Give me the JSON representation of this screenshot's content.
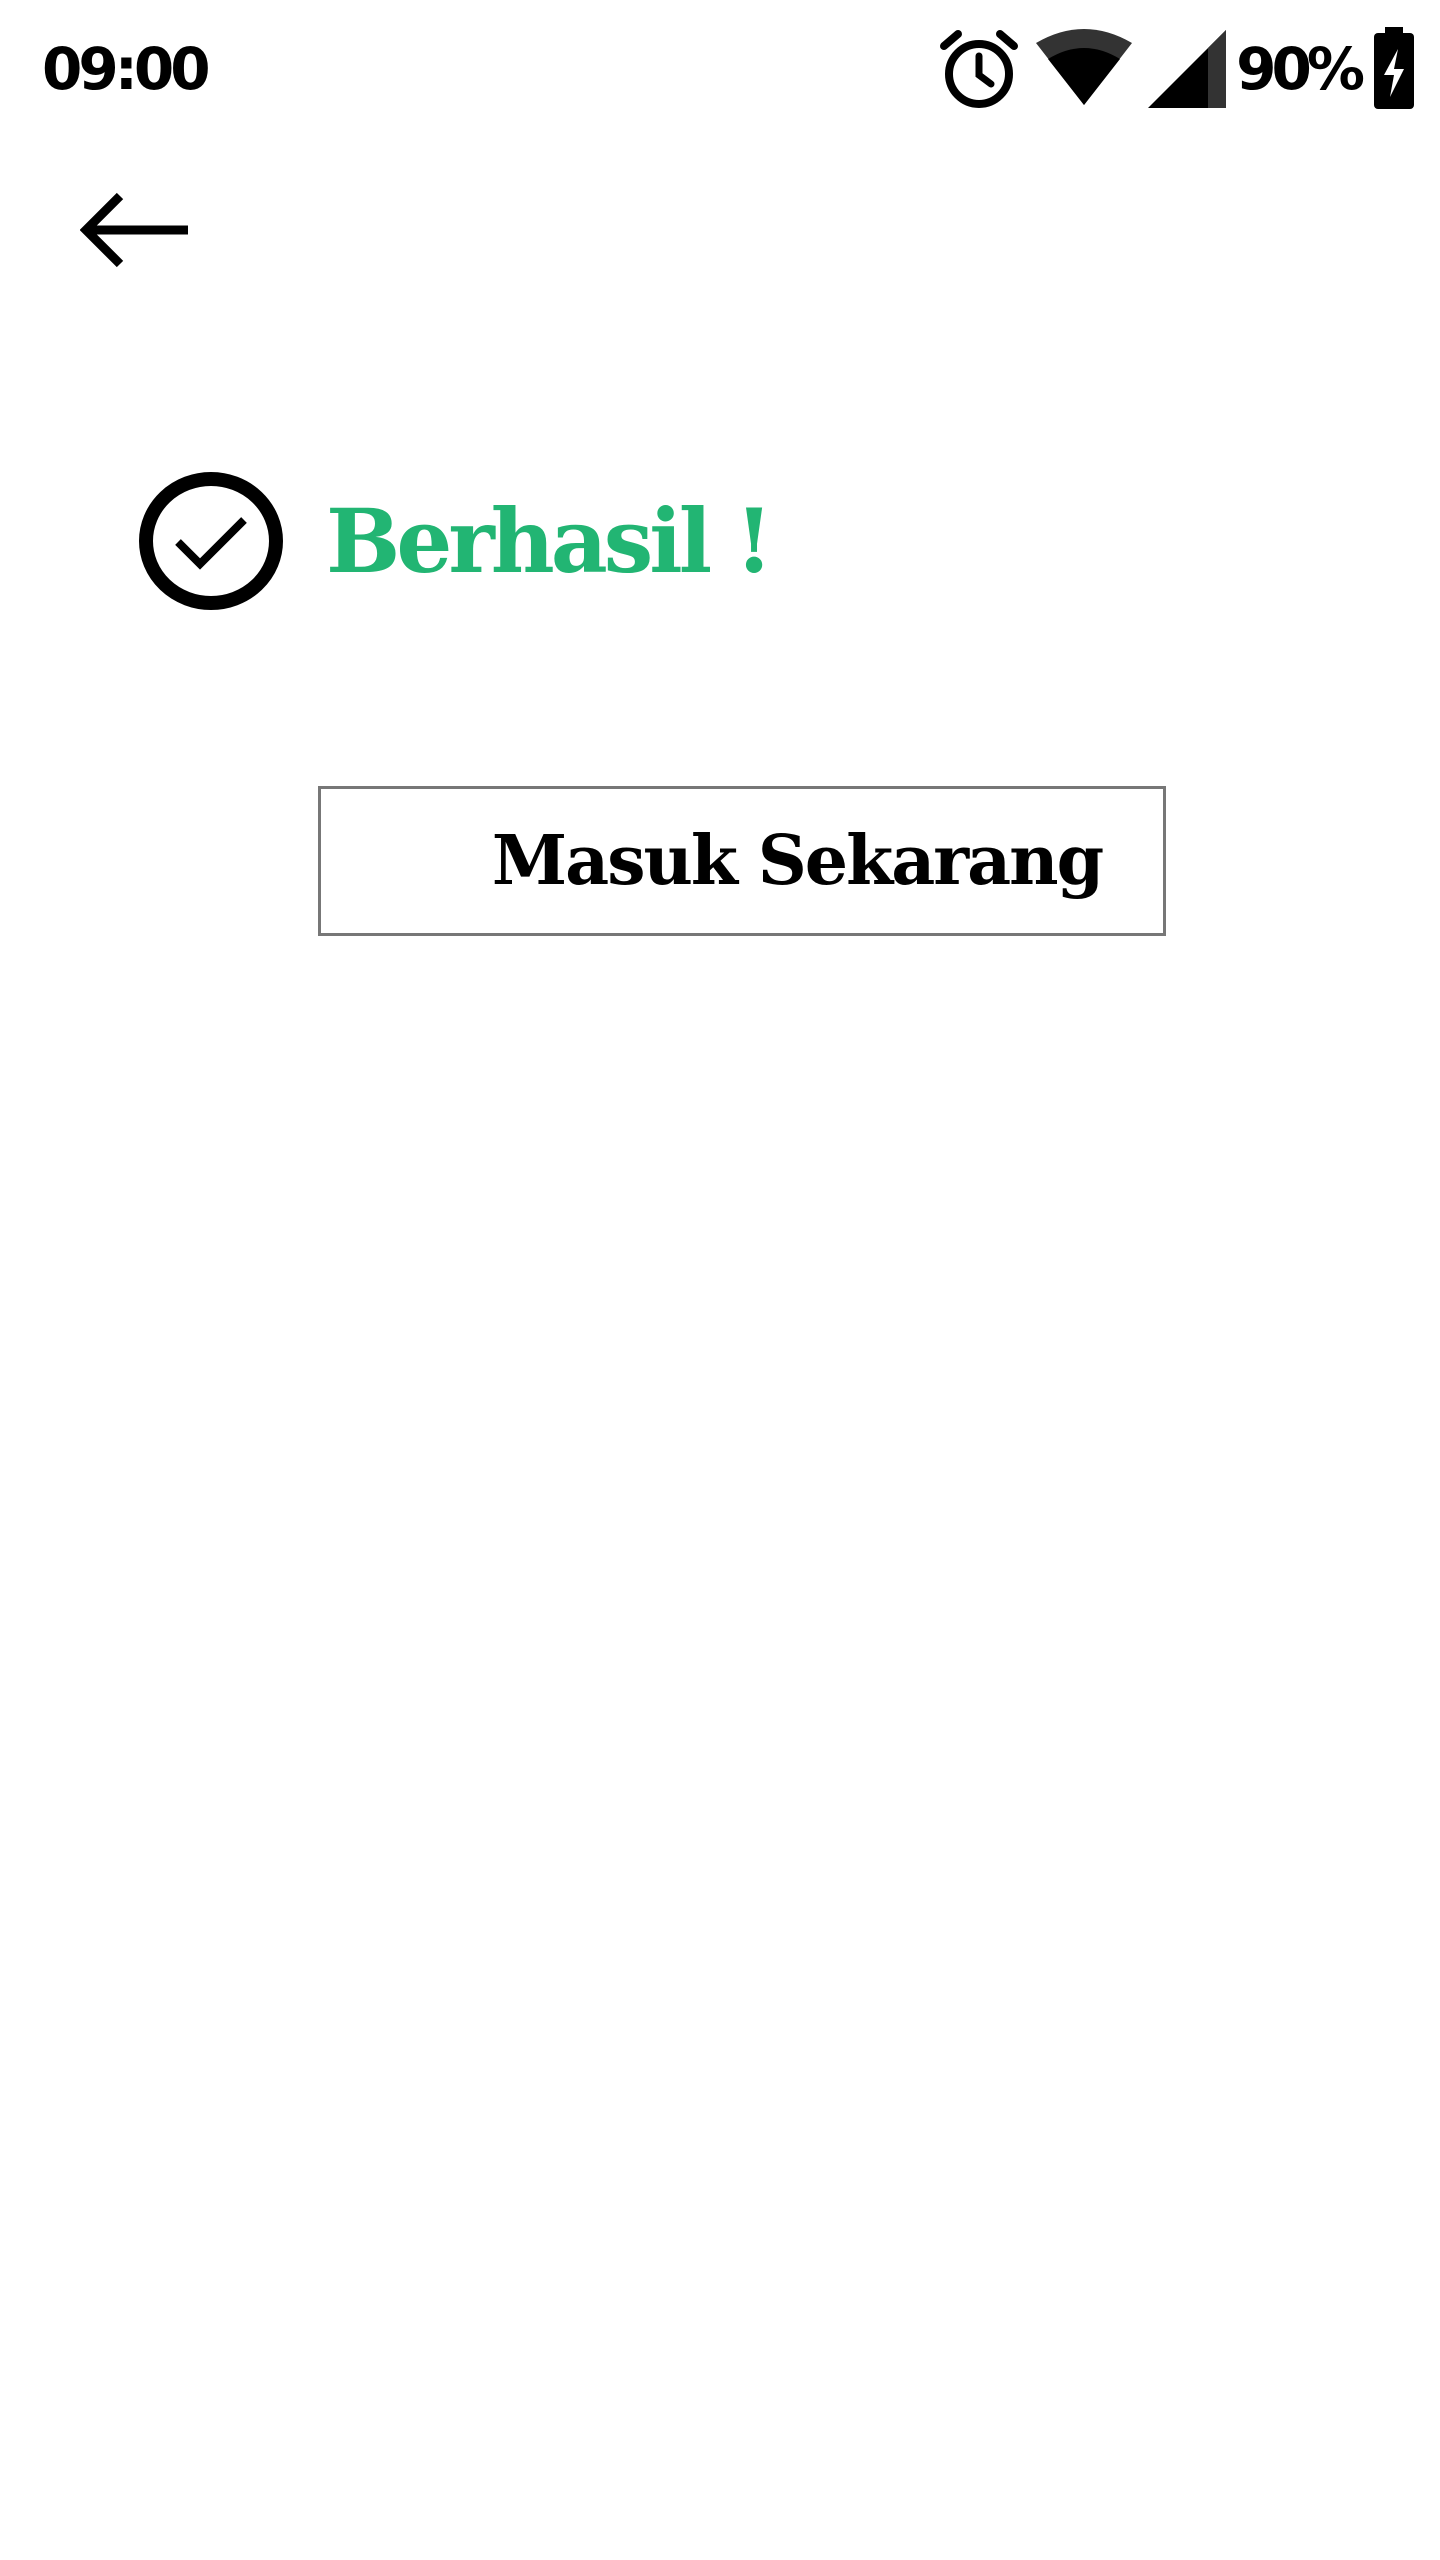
{
  "status_bar": {
    "time": "09:00",
    "battery_percent": "90%",
    "icons": [
      "alarm-icon",
      "wifi-icon",
      "cell-signal-icon",
      "battery-charging-icon"
    ]
  },
  "nav": {
    "back_icon": "arrow-left-icon"
  },
  "success": {
    "icon": "check-circle-icon",
    "title": "Berhasil !",
    "color": "#22b573"
  },
  "actions": {
    "login_label": "Masuk Sekarang"
  }
}
